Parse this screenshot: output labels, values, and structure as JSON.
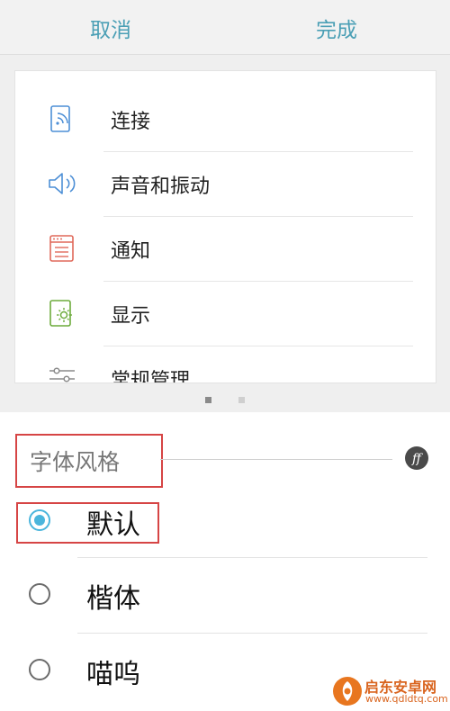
{
  "header": {
    "cancel_label": "取消",
    "done_label": "完成"
  },
  "preview": {
    "items": [
      {
        "label": "连接",
        "icon": "connection-icon"
      },
      {
        "label": "声音和振动",
        "icon": "speaker-icon"
      },
      {
        "label": "通知",
        "icon": "notification-icon"
      },
      {
        "label": "显示",
        "icon": "display-icon"
      },
      {
        "label": "常规管理",
        "icon": "sliders-icon"
      }
    ],
    "page_indicator": {
      "total": 2,
      "current": 1
    }
  },
  "font_style": {
    "title": "字体风格",
    "options": [
      {
        "label": "默认",
        "selected": true
      },
      {
        "label": "楷体",
        "selected": false
      },
      {
        "label": "喵呜",
        "selected": false
      }
    ]
  },
  "watermark": {
    "title": "启东安卓网",
    "url": "www.qdldtq.com"
  },
  "colors": {
    "accent": "#4ab5dc",
    "header_text": "#4a9fb5",
    "highlight_box": "#d64545"
  }
}
